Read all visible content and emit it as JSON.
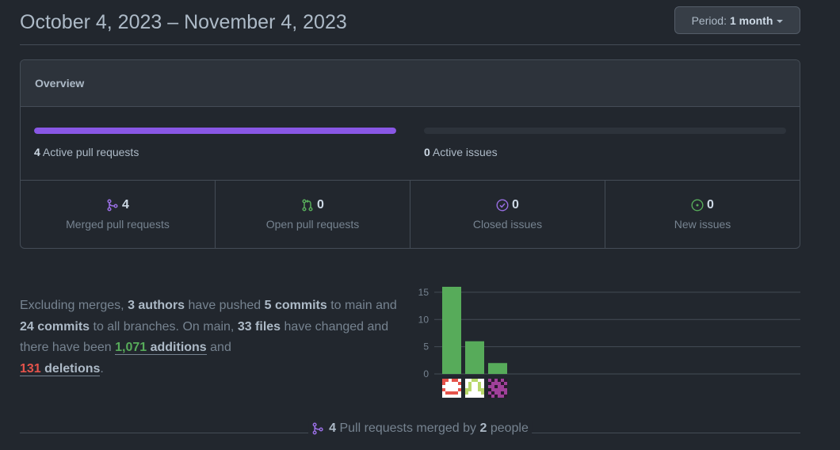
{
  "header": {
    "date_range": "October 4, 2023 – November 4, 2023",
    "period_label": "Period:",
    "period_value": "1 month"
  },
  "overview": {
    "title": "Overview",
    "pull_requests": {
      "count": "4",
      "label": "Active pull requests",
      "fill_fraction": 1.0,
      "color": "#8957e5"
    },
    "issues": {
      "count": "0",
      "label": "Active issues",
      "fill_fraction": 0.0
    },
    "stats": [
      {
        "icon": "merge-icon",
        "count": "4",
        "label": "Merged pull requests",
        "color": "#986ee2"
      },
      {
        "icon": "pull-request-icon",
        "count": "0",
        "label": "Open pull requests",
        "color": "#57ab5a"
      },
      {
        "icon": "issue-closed-icon",
        "count": "0",
        "label": "Closed issues",
        "color": "#986ee2"
      },
      {
        "icon": "issue-opened-icon",
        "count": "0",
        "label": "New issues",
        "color": "#57ab5a"
      }
    ]
  },
  "summary": {
    "t1": "Excluding merges, ",
    "authors": "3 authors",
    "t2": " have pushed ",
    "commits_main": "5 commits",
    "t3": " to main and ",
    "commits_all": "24 commits",
    "t4": " to all branches. On main, ",
    "files": "33 files",
    "t5": " have changed and there have been ",
    "additions_num": "1,071",
    "additions_word": "additions",
    "t6": " and ",
    "deletions_num": "131",
    "deletions_word": "deletions",
    "t7": "."
  },
  "chart_data": {
    "type": "bar",
    "categories": [
      "author-1",
      "author-2",
      "author-3"
    ],
    "values": [
      16,
      6,
      2
    ],
    "yticks": [
      0,
      5,
      10,
      15
    ],
    "ylim": [
      0,
      16
    ],
    "bar_color": "#57ab5a",
    "grid": true
  },
  "footer": {
    "count": "4",
    "text1": "Pull requests merged by",
    "people": "2",
    "text2": "people"
  }
}
